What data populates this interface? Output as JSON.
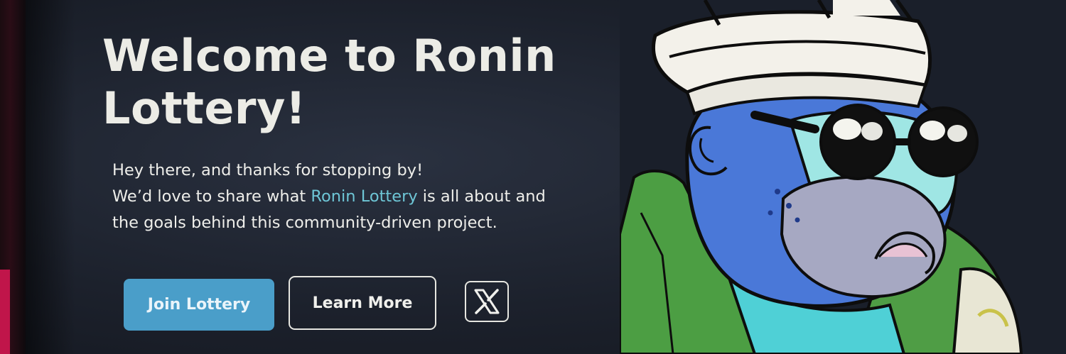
{
  "hero": {
    "title": "Welcome to Ronin Lottery!",
    "intro": "Hey there, and thanks for stopping by!",
    "line2_prefix": "We’d love to share what ",
    "brand": "Ronin Lottery",
    "line2_suffix": " is all about and",
    "line3": "the goals behind this community-driven project."
  },
  "buttons": {
    "join_label": "Join Lottery",
    "learn_label": "Learn More",
    "x_icon": "x-logo-icon"
  },
  "colors": {
    "accent": "#6ec6d6",
    "primary_button": "#4a9ec9",
    "background": "#1c212c"
  }
}
